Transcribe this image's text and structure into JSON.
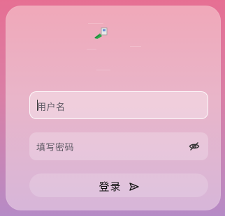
{
  "form": {
    "username_placeholder": "用户名",
    "password_placeholder": "填写密码",
    "login_label": "登录"
  },
  "icons": {
    "logo": "app-logo",
    "password_toggle": "eye-off-icon",
    "submit": "send-icon"
  },
  "colors": {
    "background_top": "#e66f93",
    "background_bottom": "#b68bc6",
    "text": "#111111",
    "placeholder": "#5e5a64"
  }
}
